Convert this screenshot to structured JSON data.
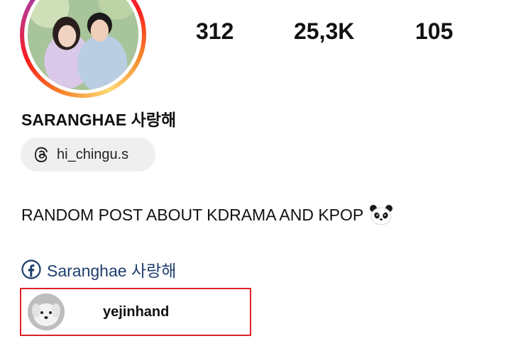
{
  "profile": {
    "name": "SARANGHAE 사랑해",
    "avatar_icon": "profile-photo-icon",
    "story_ring_colors": [
      "#f58529",
      "#fd1d1d",
      "#c13584",
      "#833ab4",
      "#feda75"
    ]
  },
  "stats": {
    "posts": "312",
    "followers": "25,3K",
    "following": "105"
  },
  "threads": {
    "icon": "threads-icon",
    "handle": "hi_chingu.s"
  },
  "bio": {
    "text": "RANDOM POST ABOUT KDRAMA AND KPOP",
    "emoji": "panda-icon"
  },
  "facebook": {
    "icon": "facebook-icon",
    "label": "Saranghae 사랑해",
    "color": "#1877f2"
  },
  "mention": {
    "username": "yejinhand",
    "avatar_icon": "dog-avatar-icon",
    "highlight_color": "#e0202a"
  }
}
